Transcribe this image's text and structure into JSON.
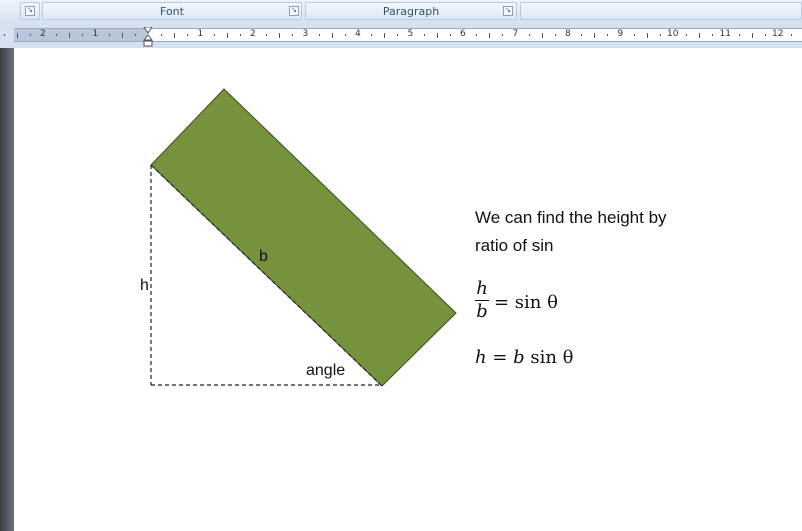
{
  "ribbon": {
    "groups": [
      {
        "label": ""
      },
      {
        "label": "Font"
      },
      {
        "label": "Paragraph"
      }
    ]
  },
  "ruler": {
    "numbers": [
      "2",
      "1",
      "1",
      "2",
      "3",
      "4",
      "5",
      "6",
      "7",
      "8",
      "9",
      "10",
      "11",
      "12"
    ]
  },
  "diagram": {
    "shape_color": "#76923c",
    "label_b": "b",
    "label_h": "h",
    "label_angle": "angle"
  },
  "text": {
    "line1": "We can find the height by",
    "line2": "ratio of sin"
  },
  "equations": {
    "frac_num": "h",
    "frac_den": "b",
    "eq1_rhs": "= sin θ",
    "eq2_lhs": "h",
    "eq2_mid": " = ",
    "eq2_b": "b",
    "eq2_rhs": " sin θ"
  }
}
